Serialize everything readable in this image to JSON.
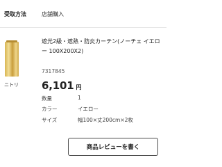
{
  "receive": {
    "label": "受取方法",
    "value": "店舗購入"
  },
  "product": {
    "title": "遮光2級・遮熱・防炎カーテン(ノーチェ イエロー 100X200X2)",
    "brand": "ニトリ",
    "sku": "7317845",
    "price": "6,101",
    "price_unit": "円",
    "image_icon": "yellow-curtain-thumbnail"
  },
  "specs": [
    {
      "label": "数量",
      "value": "1"
    },
    {
      "label": "カラー",
      "value": "イエロー"
    },
    {
      "label": "サイズ",
      "value": "幅100×丈200cm×2枚"
    }
  ],
  "actions": {
    "review_label": "商品レビューを書く"
  },
  "colors": {
    "divider": "#e6e6e6",
    "text": "#333333",
    "button_border": "#4a4a4a",
    "curtain": "#d8b552"
  }
}
